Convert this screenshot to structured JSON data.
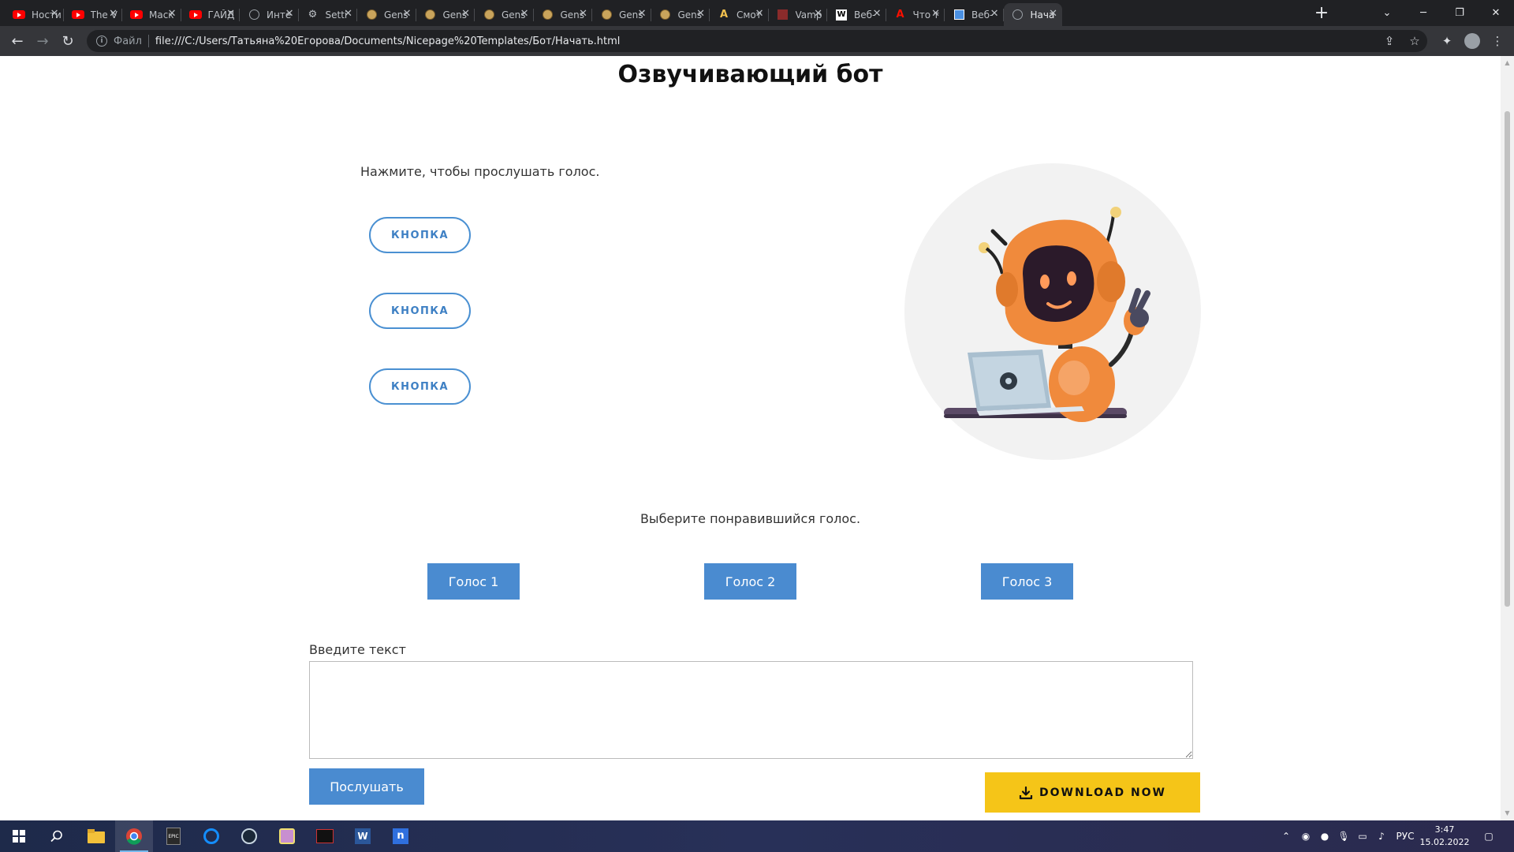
{
  "browser": {
    "tabs": [
      {
        "title": "Ности",
        "icon": "youtube-icon"
      },
      {
        "title": "The V",
        "icon": "youtube-icon"
      },
      {
        "title": "Маск",
        "icon": "youtube-icon"
      },
      {
        "title": "ГАЙД",
        "icon": "youtube-icon"
      },
      {
        "title": "Инте",
        "icon": "globe-icon"
      },
      {
        "title": "Setti",
        "icon": "settings-icon"
      },
      {
        "title": "Gens",
        "icon": "genshin-icon"
      },
      {
        "title": "Gens",
        "icon": "genshin-icon"
      },
      {
        "title": "Gens",
        "icon": "genshin-icon"
      },
      {
        "title": "Gens",
        "icon": "genshin-icon"
      },
      {
        "title": "Gens",
        "icon": "genshin-icon"
      },
      {
        "title": "Gens",
        "icon": "genshin-icon"
      },
      {
        "title": "Смот",
        "icon": "anime-icon"
      },
      {
        "title": "Vamp",
        "icon": "vampire-icon"
      },
      {
        "title": "Веб-",
        "icon": "wix-icon"
      },
      {
        "title": "Что т",
        "icon": "adobe-icon"
      },
      {
        "title": "Веб-",
        "icon": "grid-icon"
      },
      {
        "title": "Нача",
        "icon": "globe-icon",
        "active": true
      }
    ],
    "address": {
      "scheme_label": "Файл",
      "url": "file:///C:/Users/Татьяна%20Егорова/Documents/Nicepage%20Templates/Бот/Начать.html"
    }
  },
  "page": {
    "title": "Озвучивающий бот",
    "hint": "Нажмите, чтобы прослушать голос.",
    "sample_buttons": [
      "КНОПКА",
      "КНОПКА",
      "КНОПКА"
    ],
    "choose_label": "Выберите понравившийся голос.",
    "voice_buttons": [
      "Голос 1",
      "Голос 2",
      "Голос 3"
    ],
    "text_label": "Введите текст",
    "textarea_value": "",
    "listen_button": "Послушать",
    "download_button": "DOWNLOAD NOW"
  },
  "taskbar": {
    "language": "РУС",
    "time": "3:47",
    "date": "15.02.2022"
  },
  "colors": {
    "accent_blue": "#4a8bd0",
    "outline_blue": "#4a90d2",
    "download_yellow": "#f5c518",
    "robot_orange": "#f08a3c"
  }
}
